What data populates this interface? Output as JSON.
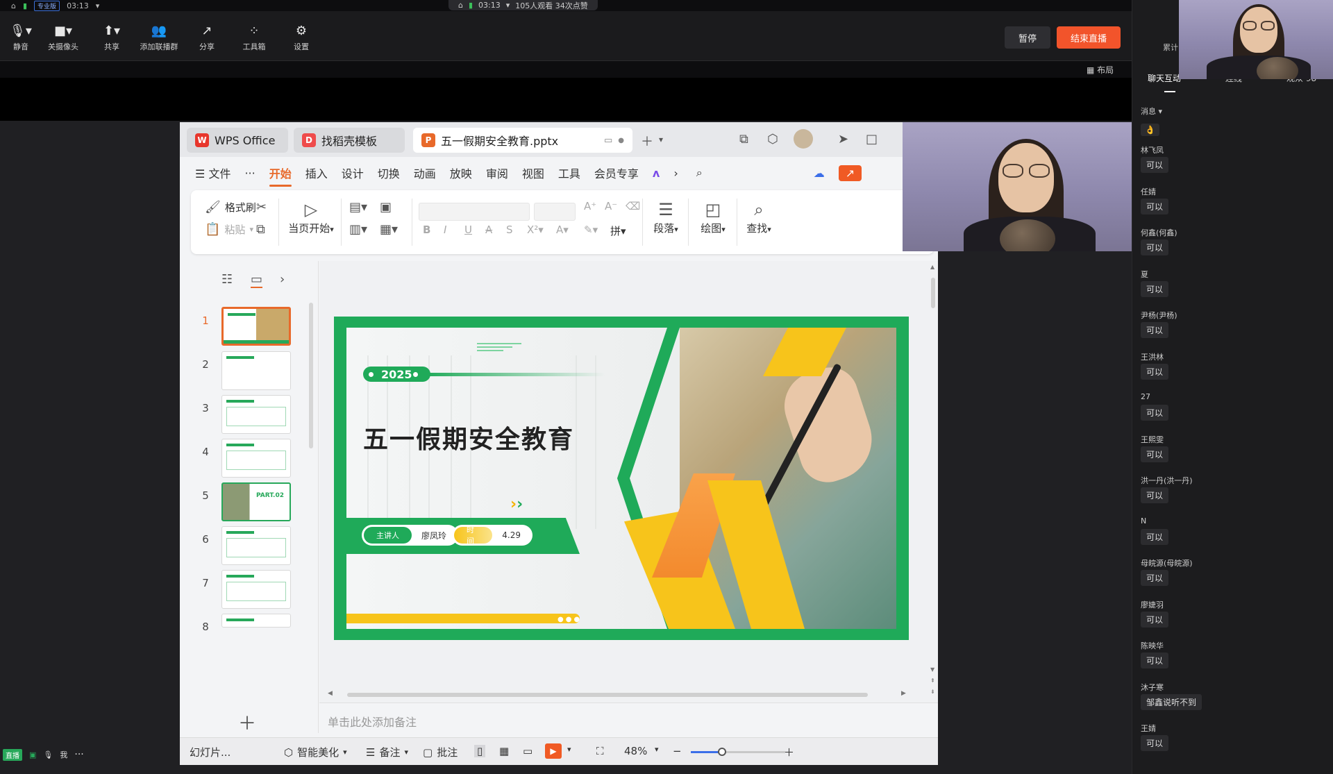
{
  "topbar": {
    "status": "专业版",
    "time": "03:13",
    "live_time": "03:13",
    "live_stats": "105人观看  34次点赞"
  },
  "live_toolbar": {
    "tools": [
      {
        "label": "静音",
        "icon": "microphone-icon"
      },
      {
        "label": "关摄像头",
        "icon": "camera-icon"
      },
      {
        "label": "共享",
        "icon": "share-screen-icon"
      },
      {
        "label": "添加联播群",
        "icon": "add-group-icon"
      },
      {
        "label": "分享",
        "icon": "share-icon"
      },
      {
        "label": "工具箱",
        "icon": "toolbox-icon"
      },
      {
        "label": "设置",
        "icon": "gear-icon"
      }
    ],
    "pause_label": "暂停",
    "end_label": "结束直播",
    "layout_label": "布局"
  },
  "wps": {
    "tabs": [
      "WPS Office",
      "找稻壳模板",
      "五一假期安全教育.pptx"
    ],
    "menu": [
      "文件",
      "···",
      "开始",
      "插入",
      "设计",
      "切换",
      "动画",
      "放映",
      "审阅",
      "视图",
      "工具",
      "会员专享"
    ],
    "active_menu": "开始",
    "ribbon": {
      "format_painter": "格式刷",
      "paste": "粘贴",
      "play_from_current": "当页开始",
      "paragraph": "段落",
      "draw": "绘图",
      "find": "查找"
    },
    "slides": [
      "1",
      "2",
      "3",
      "4",
      "5",
      "6",
      "7",
      "8"
    ],
    "selected_slide": "1",
    "thumb5_text": "PART.02",
    "notes_placeholder": "单击此处添加备注",
    "status": {
      "slide_label": "幻灯片...",
      "beautify": "智能美化",
      "notes": "备注",
      "comments": "批注",
      "zoom": "48%",
      "zoom_value": 0.33
    }
  },
  "slide": {
    "year": "2025",
    "title": "五一假期安全教育",
    "speaker_label": "主讲人",
    "speaker_name": "廖凤玲",
    "time_label": "时间",
    "time_value": "4.29"
  },
  "chat": {
    "tabs": [
      "聊天互动",
      "连线",
      "观众 98"
    ],
    "partial_label": "累计",
    "filter_label": "消息",
    "first_emoji": "👌",
    "messages": [
      {
        "name": "林飞凤",
        "text": "可以"
      },
      {
        "name": "任婧",
        "text": "可以"
      },
      {
        "name": "何鑫(何鑫)",
        "text": "可以"
      },
      {
        "name": "夏",
        "text": "可以"
      },
      {
        "name": "尹杨(尹杨)",
        "text": "可以"
      },
      {
        "name": "王洪林",
        "text": "可以"
      },
      {
        "name": "27",
        "text": "可以"
      },
      {
        "name": "王熙雯",
        "text": "可以"
      },
      {
        "name": "洪一丹(洪一丹)",
        "text": "可以"
      },
      {
        "name": "N",
        "text": "可以"
      },
      {
        "name": "母皖源(母皖源)",
        "text": "可以"
      },
      {
        "name": "廖婕羽",
        "text": "可以"
      },
      {
        "name": "陈映华",
        "text": "可以"
      },
      {
        "name": "沐子寒",
        "text": "邹鑫说听不到"
      },
      {
        "name": "王婧",
        "text": "可以"
      }
    ]
  },
  "bottombar": {
    "live_tag": "直播",
    "me_label": "我"
  },
  "colors": {
    "accent": "#e8692a",
    "end_button": "#f2542b",
    "slide_green": "#1faa59",
    "slide_yellow": "#f7c41b"
  }
}
